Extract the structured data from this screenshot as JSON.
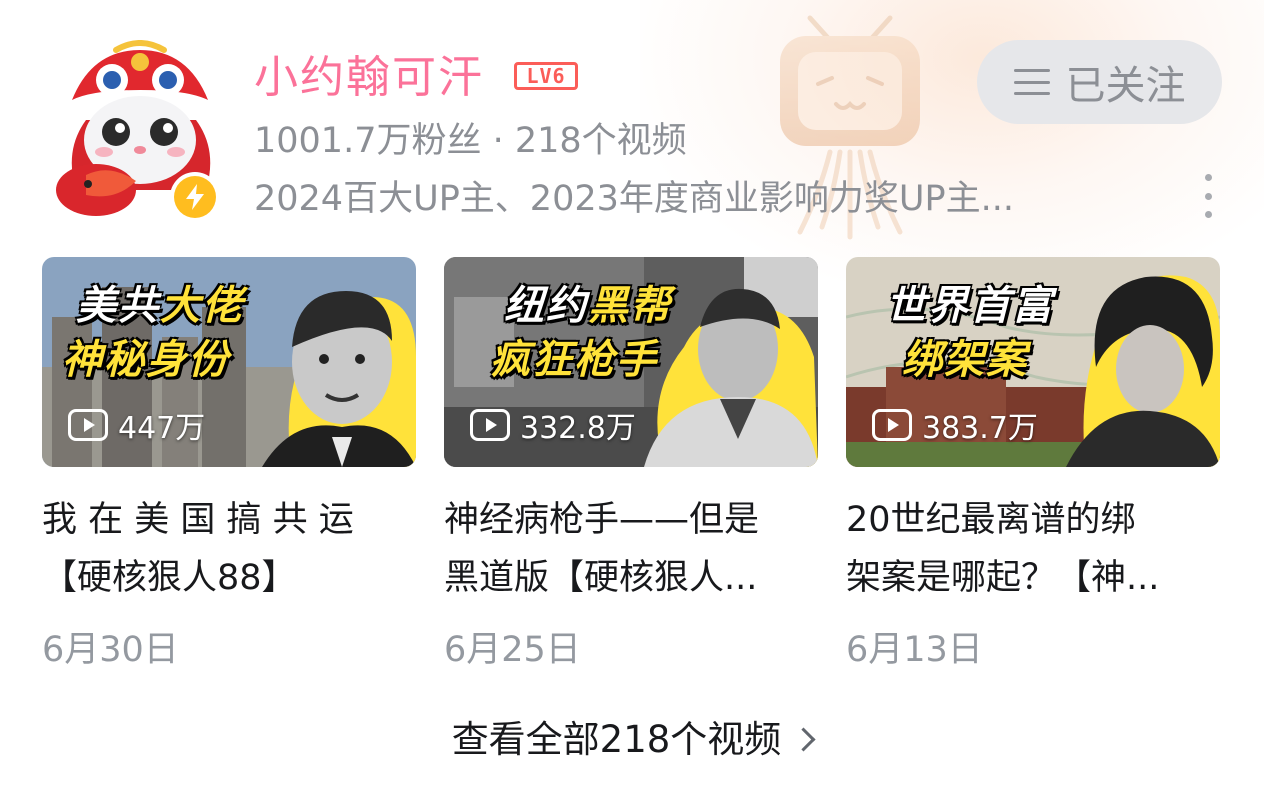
{
  "creator": {
    "name": "小约翰可汗",
    "level": "LV6",
    "stats": "1001.7万粉丝 · 218个视频",
    "description": "2024百大UP主、2023年度商业影响力奖UP主...",
    "follow_label": "已关注"
  },
  "videos": [
    {
      "thumb_line1_a": "美共",
      "thumb_line1_b": "大佬",
      "thumb_line2": "神秘身份",
      "views": "447万",
      "title_line1": "我 在 美 国 搞 共 运",
      "title_line2": "【硬核狠人88】",
      "date": "6月30日"
    },
    {
      "thumb_line1_a": "纽约",
      "thumb_line1_b": "黑帮",
      "thumb_line2": "疯狂枪手",
      "views": "332.8万",
      "title_line1": "神经病枪手——但是",
      "title_line2": "黑道版【硬核狠人...",
      "date": "6月25日"
    },
    {
      "thumb_line1": "世界首富",
      "thumb_line2": "绑架案",
      "views": "383.7万",
      "title_line1": "20世纪最离谱的绑",
      "title_line2": "架案是哪起？【神...",
      "date": "6月13日"
    }
  ],
  "see_all_label": "查看全部218个视频",
  "colors": {
    "name_pink": "#fb7299",
    "level_red": "#fb5d58",
    "muted_text": "#8c8f95",
    "thumb_yellow": "#ffe23a",
    "badge_yellow": "#ffbd1f"
  }
}
